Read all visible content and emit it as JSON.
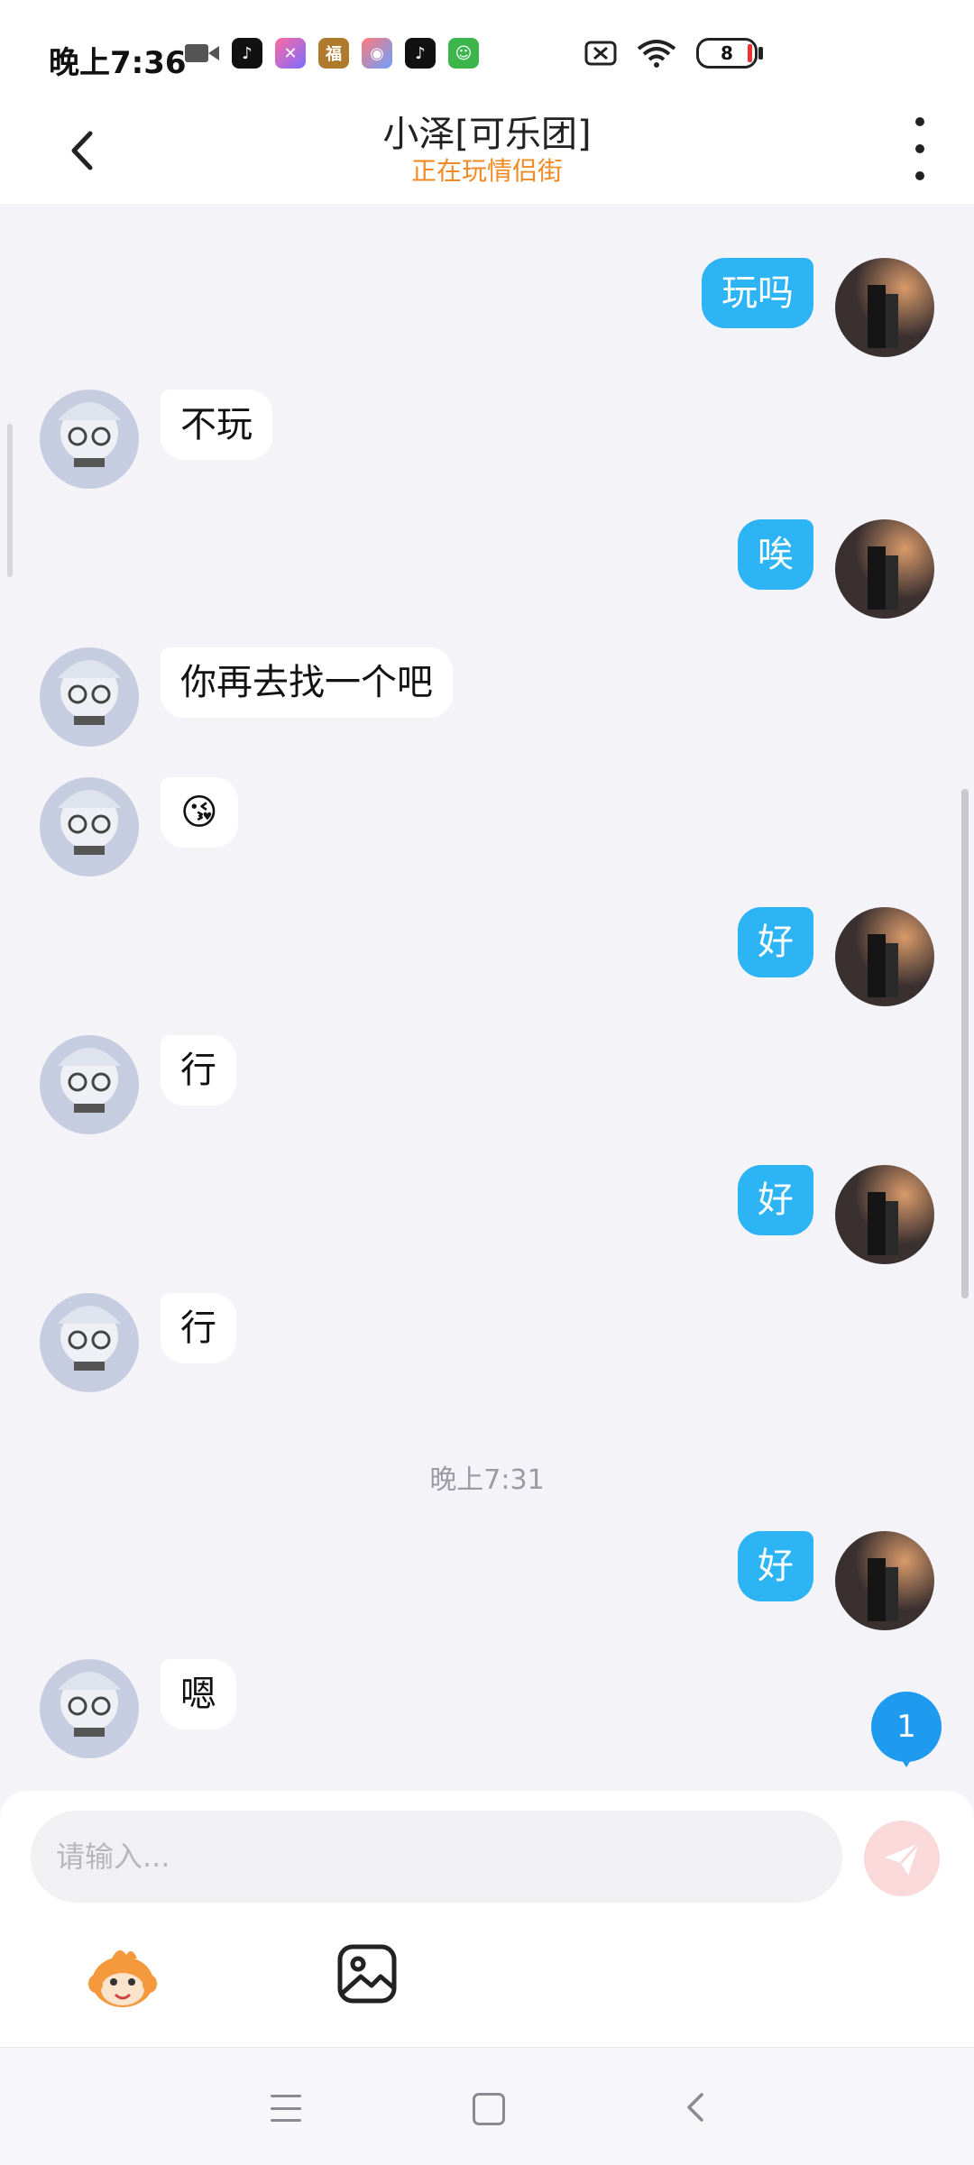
{
  "status_bar": {
    "time": "晚上7:36",
    "icons": [
      "video-icon",
      "tiktok-icon",
      "app-icon",
      "app-icon",
      "game-icon",
      "tiktok-icon",
      "android-icon"
    ],
    "battery": "8"
  },
  "header": {
    "title": "小泽[可乐团]",
    "subtitle": "正在玩情侣街"
  },
  "messages": [
    {
      "side": "right",
      "text": "玩吗"
    },
    {
      "side": "left",
      "text": "不玩"
    },
    {
      "side": "right",
      "text": "唉"
    },
    {
      "side": "left",
      "text": "你再去找一个吧"
    },
    {
      "side": "left",
      "text": "😘"
    },
    {
      "side": "right",
      "text": "好"
    },
    {
      "side": "left",
      "text": "行"
    },
    {
      "side": "right",
      "text": "好"
    },
    {
      "side": "left",
      "text": "行"
    },
    {
      "side": "right",
      "text": "好"
    },
    {
      "side": "left",
      "text": "嗯"
    }
  ],
  "timestamp": "晚上7:31",
  "unread_count": "1",
  "input": {
    "placeholder": "请输入..."
  },
  "colors": {
    "accent_blue": "#2CB4F5",
    "subtitle_orange": "#F08A24"
  }
}
